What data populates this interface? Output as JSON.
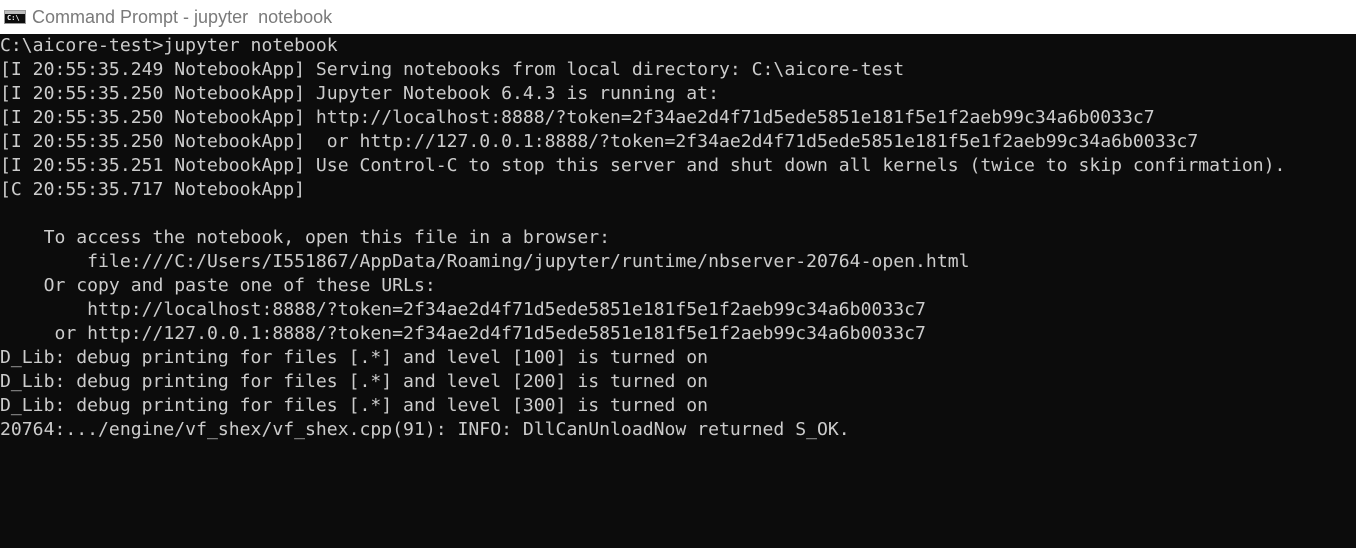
{
  "window": {
    "title": "Command Prompt - jupyter  notebook",
    "icon": "cmd-icon",
    "icon_glyph": "C:\\"
  },
  "console": {
    "colors": {
      "background": "#0c0c0c",
      "text": "#cccccc"
    },
    "lines": [
      "C:\\aicore-test>jupyter notebook",
      "[I 20:55:35.249 NotebookApp] Serving notebooks from local directory: C:\\aicore-test",
      "[I 20:55:35.250 NotebookApp] Jupyter Notebook 6.4.3 is running at:",
      "[I 20:55:35.250 NotebookApp] http://localhost:8888/?token=2f34ae2d4f71d5ede5851e181f5e1f2aeb99c34a6b0033c7",
      "[I 20:55:35.250 NotebookApp]  or http://127.0.0.1:8888/?token=2f34ae2d4f71d5ede5851e181f5e1f2aeb99c34a6b0033c7",
      "[I 20:55:35.251 NotebookApp] Use Control-C to stop this server and shut down all kernels (twice to skip confirmation).",
      "[C 20:55:35.717 NotebookApp]",
      "",
      "    To access the notebook, open this file in a browser:",
      "        file:///C:/Users/I551867/AppData/Roaming/jupyter/runtime/nbserver-20764-open.html",
      "    Or copy and paste one of these URLs:",
      "        http://localhost:8888/?token=2f34ae2d4f71d5ede5851e181f5e1f2aeb99c34a6b0033c7",
      "     or http://127.0.0.1:8888/?token=2f34ae2d4f71d5ede5851e181f5e1f2aeb99c34a6b0033c7",
      "D_Lib: debug printing for files [.*] and level [100] is turned on",
      "D_Lib: debug printing for files [.*] and level [200] is turned on",
      "D_Lib: debug printing for files [.*] and level [300] is turned on",
      "20764:.../engine/vf_shex/vf_shex.cpp(91): INFO: DllCanUnloadNow returned S_OK."
    ]
  }
}
